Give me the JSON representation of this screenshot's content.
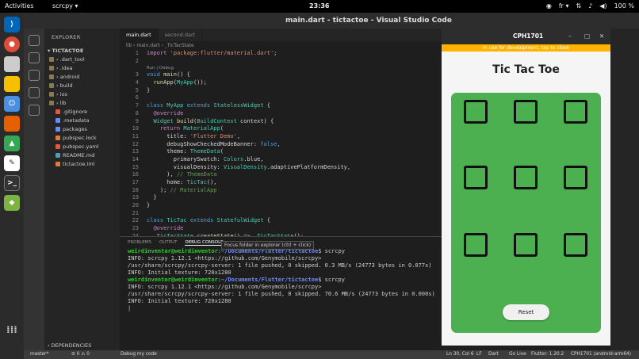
{
  "topbar": {
    "activities": "Activities",
    "app": "scrcpy ▾",
    "clock": "23:36",
    "lang": "fr ▾",
    "battery": "100 %"
  },
  "window": {
    "title": "main.dart - tictactoe - Visual Studio Code"
  },
  "explorer": {
    "header": "EXPLORER",
    "project": "▾ TICTACTOE",
    "items": [
      {
        "label": "› .dart_tool",
        "color": "#8a7a50",
        "indent": 6
      },
      {
        "label": "› .idea",
        "color": "#8a7a50",
        "indent": 6
      },
      {
        "label": "› android",
        "color": "#8a7a50",
        "indent": 6
      },
      {
        "label": "› build",
        "color": "#8a7a50",
        "indent": 6
      },
      {
        "label": "› ios",
        "color": "#8a7a50",
        "indent": 6
      },
      {
        "label": "› lib",
        "color": "#8a7a50",
        "indent": 6
      },
      {
        "label": ".gitignore",
        "color": "#e05a3a",
        "indent": 14
      },
      {
        "label": ".metadata",
        "color": "#6a8cff",
        "indent": 14
      },
      {
        "label": "packages",
        "color": "#6a8cff",
        "indent": 14
      },
      {
        "label": "pubspec.lock",
        "color": "#e07b3a",
        "indent": 14
      },
      {
        "label": "pubspec.yaml",
        "color": "#e05a3a",
        "indent": 14
      },
      {
        "label": "README.md",
        "color": "#519aba",
        "indent": 14
      },
      {
        "label": "tictactoe.iml",
        "color": "#e07b3a",
        "indent": 14
      }
    ],
    "dependencies": "› DEPENDENCIES"
  },
  "editor": {
    "tabs": [
      "main.dart",
      "second.dart"
    ],
    "breadcrumb": "lib › main.dart › _TicTacState",
    "codelens": "Run | Debug",
    "lines": [
      {
        "n": "1",
        "html": "<span style=\"color:#c586c0\">import</span> <span style=\"color:#ce9178\">'package:flutter/material.dart'</span>;"
      },
      {
        "n": "2",
        "html": ""
      },
      {
        "n": "3",
        "html": "<span style=\"color:#569cd6\">void</span> <span style=\"color:#dcdcaa\">main</span>() {"
      },
      {
        "n": "4",
        "html": "  <span style=\"color:#dcdcaa\">runApp</span>(<span style=\"color:#4ec9b0\">MyApp</span>());"
      },
      {
        "n": "5",
        "html": "}"
      },
      {
        "n": "6",
        "html": ""
      },
      {
        "n": "7",
        "html": "<span style=\"color:#569cd6\">class</span> <span style=\"color:#4ec9b0\">MyApp</span> <span style=\"color:#569cd6\">extends</span> <span style=\"color:#4ec9b0\">StatelessWidget</span> {"
      },
      {
        "n": "8",
        "html": "  <span style=\"color:#c586c0\">@override</span>"
      },
      {
        "n": "9",
        "html": "  <span style=\"color:#4ec9b0\">Widget</span> <span style=\"color:#dcdcaa\">build</span>(<span style=\"color:#4ec9b0\">BuildContext</span> context) {"
      },
      {
        "n": "10",
        "html": "    <span style=\"color:#c586c0\">return</span> <span style=\"color:#4ec9b0\">MaterialApp</span>("
      },
      {
        "n": "11",
        "html": "      title: <span style=\"color:#ce9178\">'Flutter Demo'</span>,"
      },
      {
        "n": "12",
        "html": "      debugShowCheckedModeBanner: <span style=\"color:#569cd6\">false</span>,"
      },
      {
        "n": "13",
        "html": "      theme: <span style=\"color:#4ec9b0\">ThemeData</span>("
      },
      {
        "n": "14",
        "html": "        primarySwatch: <span style=\"color:#4ec9b0\">Colors</span>.blue,"
      },
      {
        "n": "15",
        "html": "        visualDensity: <span style=\"color:#4ec9b0\">VisualDensity</span>.adaptivePlatformDensity,"
      },
      {
        "n": "16",
        "html": "      ), <span style=\"color:#6a9955\">// ThemeData</span>"
      },
      {
        "n": "17",
        "html": "      home: <span style=\"color:#4ec9b0\">TicTac</span>(),"
      },
      {
        "n": "18",
        "html": "    ); <span style=\"color:#6a9955\">// MaterialApp</span>"
      },
      {
        "n": "19",
        "html": "  }"
      },
      {
        "n": "20",
        "html": "}"
      },
      {
        "n": "21",
        "html": ""
      },
      {
        "n": "22",
        "html": "<span style=\"color:#569cd6\">class</span> <span style=\"color:#4ec9b0\">TicTac</span> <span style=\"color:#569cd6\">extends</span> <span style=\"color:#4ec9b0\">StatefulWidget</span> {"
      },
      {
        "n": "23",
        "html": "  <span style=\"color:#c586c0\">@override</span>"
      },
      {
        "n": "24",
        "html": "  <span style=\"color:#4ec9b0\">_TicTacState</span> <span style=\"color:#dcdcaa\">createState</span>() => <span style=\"color:#4ec9b0\">_TicTacState</span>();"
      }
    ]
  },
  "panel": {
    "tabs": [
      "PROBLEMS",
      "OUTPUT",
      "DEBUG CONSOLE"
    ],
    "tooltip": "Focus folder in explorer (ctrl + click)",
    "lines": [
      {
        "html": "<span class=\"u\">weirdinventor@weirdinventor</span>:<span class=\"p\">~/Documents/Flutter/tictactoe</span>$ scrcpy"
      },
      {
        "html": "INFO: scrcpy 1.12.1 &lt;https://github.com/Genymobile/scrcpy&gt;"
      },
      {
        "html": "/usr/share/scrcpy/scrcpy-server: 1 file pushed, 0 skipped. 0.3 MB/s (24773 bytes in 0.077s)"
      },
      {
        "html": "INFO: Initial texture: 720x1280"
      },
      {
        "html": "<span class=\"u\">weirdinventor@weirdinventor</span>:<span class=\"p\">~/Documents/Flutter/tictactoe</span>$ scrcpy"
      },
      {
        "html": "INFO: scrcpy 1.12.1 &lt;https://github.com/Genymobile/scrcpy&gt;"
      },
      {
        "html": "/usr/share/scrcpy/scrcpy-server: 1 file pushed, 0 skipped. 70.6 MB/s (24773 bytes in 0.000s)"
      },
      {
        "html": "INFO: Initial texture: 720x1280"
      }
    ]
  },
  "status": {
    "branch": "master*",
    "sync": "⊘ 0 ⚠ 0",
    "debug": "Debug my code",
    "position": "Ln 30, Col 6",
    "eol": "LF",
    "lang": "Dart",
    "golive": "Go Live",
    "flutter": "Flutter: 1.20.2",
    "device": "CPH1701 (android-arm64)"
  },
  "phone": {
    "window_title": "CPH1701",
    "banner": "In use for development, tap to close",
    "app_title": "Tic Tac Toe",
    "reset": "Reset",
    "board_color": "#4caf50"
  }
}
